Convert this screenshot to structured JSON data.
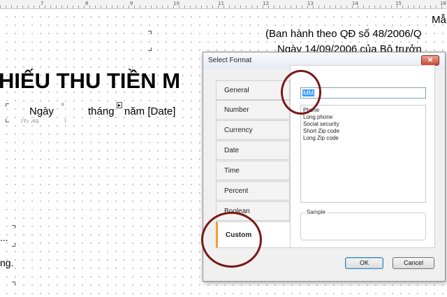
{
  "ruler": {
    "labels": [
      "7",
      "8",
      "9",
      "10",
      "11",
      "12",
      "13",
      "14",
      "15",
      "16"
    ]
  },
  "report": {
    "top_right_line1": "Mẫ",
    "top_right_line2": "(Ban hành theo QĐ số 48/2006/Q",
    "top_right_line3": "Ngày 14/09/2006 của Bộ trưởn",
    "title": "HIẾU THU TIỀN M",
    "date_ngay": "Ngày",
    "date_thang": "tháng",
    "date_nam": "năm [Date]",
    "partial_hidden": "[Tr đã ... ... ... ]",
    "ellipsis": "...",
    "left_text": "ng."
  },
  "dialog": {
    "title": "Select Format",
    "close_symbol": "✕",
    "tabs": [
      {
        "label": "General"
      },
      {
        "label": "Number"
      },
      {
        "label": "Currency"
      },
      {
        "label": "Date"
      },
      {
        "label": "Time"
      },
      {
        "label": "Percent"
      },
      {
        "label": "Boolean"
      },
      {
        "label": "Custom"
      }
    ],
    "active_tab": "Custom",
    "format_input_value": "MM",
    "format_list": [
      "Phone",
      "Long phone",
      "Social security",
      "Short Zip code",
      "Long Zip code"
    ],
    "sample_label": "Sample",
    "ok_label": "OK",
    "cancel_label": "Cancel"
  },
  "colors": {
    "annotation_circle": "#7a1818",
    "active_tab_accent": "#f0a030",
    "selection": "#3399ff",
    "close_button": "#c74a32"
  }
}
